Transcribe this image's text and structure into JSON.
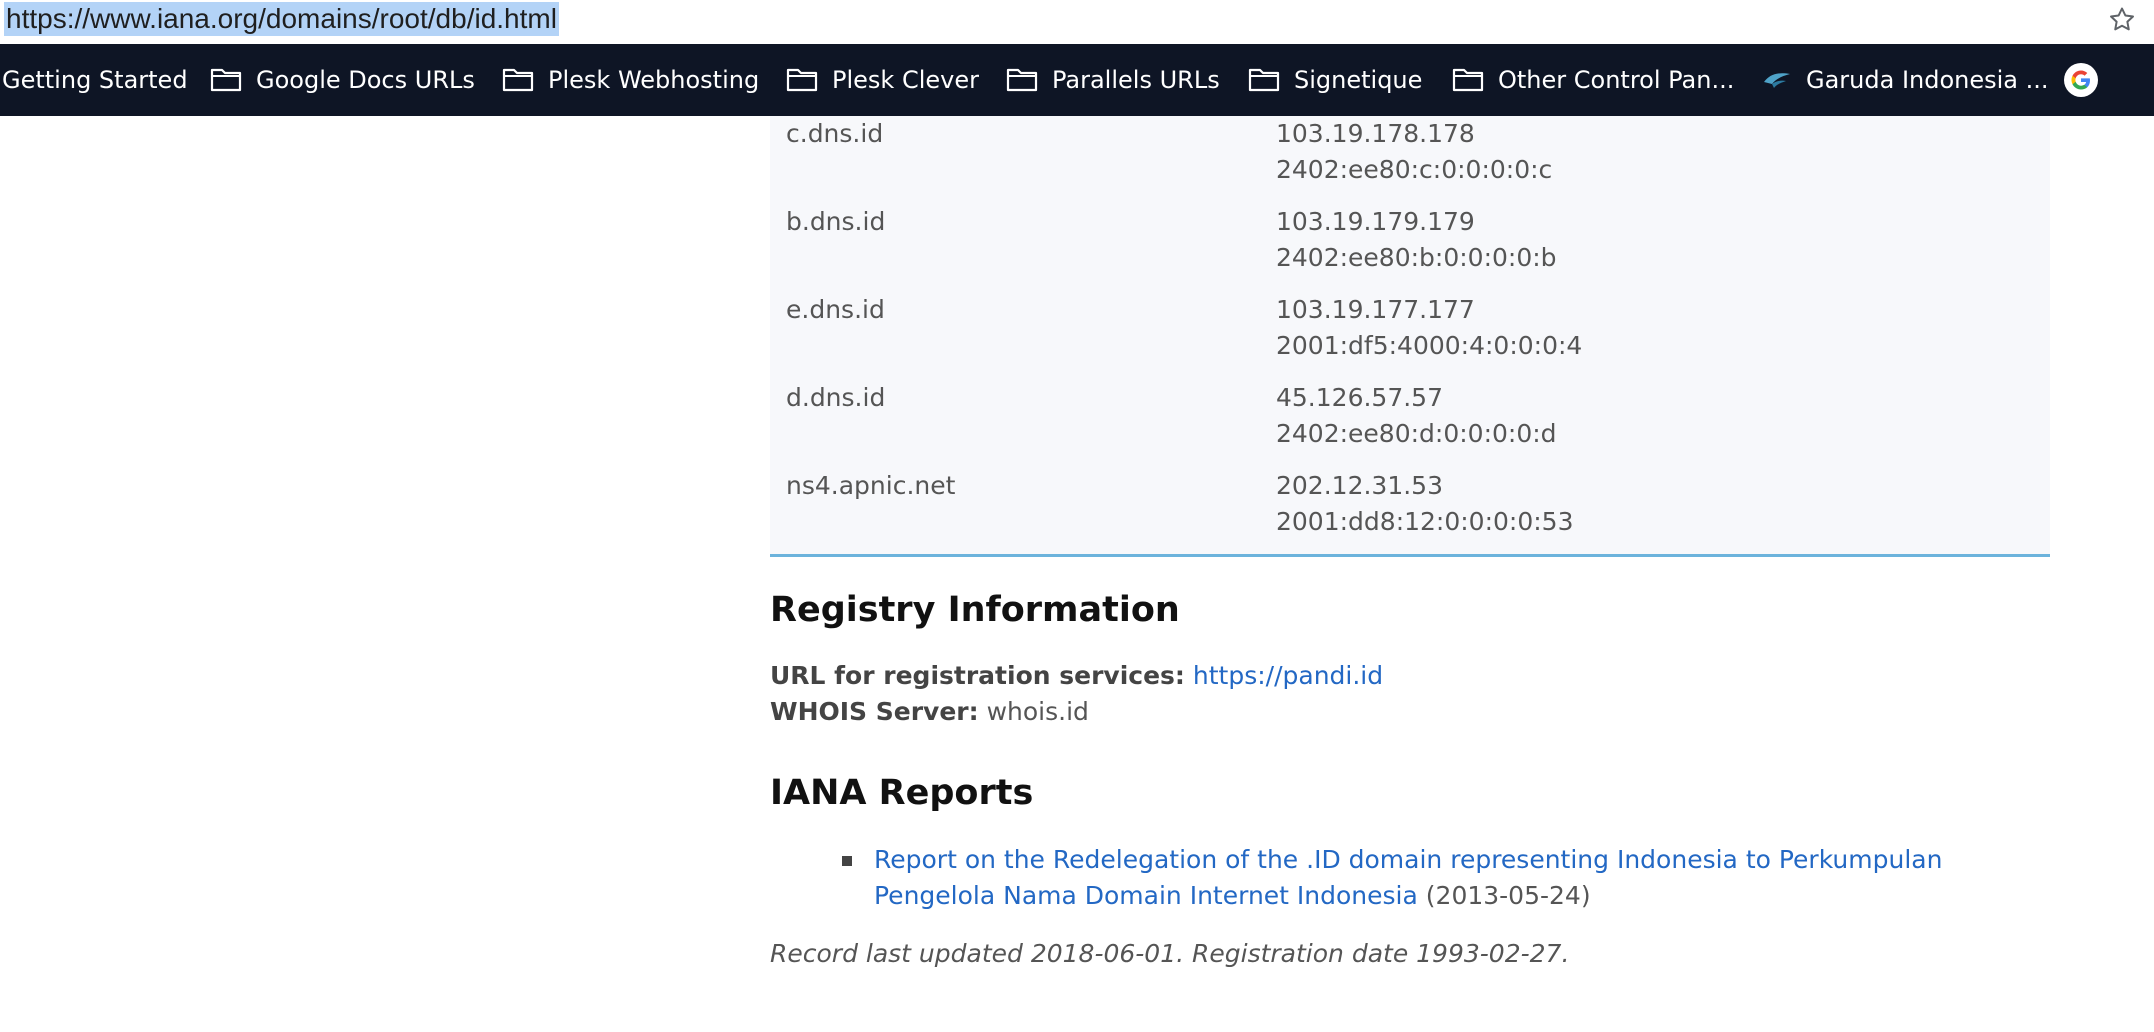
{
  "browser": {
    "url": "https://www.iana.org/domains/root/db/id.html",
    "bookmarks": [
      {
        "label": "Getting Started"
      },
      {
        "label": "Google Docs URLs"
      },
      {
        "label": "Plesk Webhosting"
      },
      {
        "label": "Plesk Clever"
      },
      {
        "label": "Parallels URLs"
      },
      {
        "label": "Signetique"
      },
      {
        "label": "Other Control Pan..."
      },
      {
        "label": "Garuda Indonesia ..."
      }
    ]
  },
  "nameservers": [
    {
      "host": "c.dns.id",
      "ipv4": "103.19.178.178",
      "ipv6": "2402:ee80:c:0:0:0:0:c"
    },
    {
      "host": "b.dns.id",
      "ipv4": "103.19.179.179",
      "ipv6": "2402:ee80:b:0:0:0:0:b"
    },
    {
      "host": "e.dns.id",
      "ipv4": "103.19.177.177",
      "ipv6": "2001:df5:4000:4:0:0:0:4"
    },
    {
      "host": "d.dns.id",
      "ipv4": "45.126.57.57",
      "ipv6": "2402:ee80:d:0:0:0:0:d"
    },
    {
      "host": "ns4.apnic.net",
      "ipv4": "202.12.31.53",
      "ipv6": "2001:dd8:12:0:0:0:0:53"
    }
  ],
  "registry": {
    "title": "Registry Information",
    "url_label": "URL for registration services:",
    "url_value": "https://pandi.id",
    "whois_label": "WHOIS Server:",
    "whois_value": "whois.id"
  },
  "reports": {
    "title": "IANA Reports",
    "items": [
      {
        "link_text": "Report on the Redelegation of the .ID domain representing Indonesia to Perkumpulan Pengelola Nama Domain Internet Indonesia",
        "date": "(2013-05-24)"
      }
    ]
  },
  "record": {
    "text": "Record last updated 2018-06-01. Registration date 1993-02-27."
  }
}
